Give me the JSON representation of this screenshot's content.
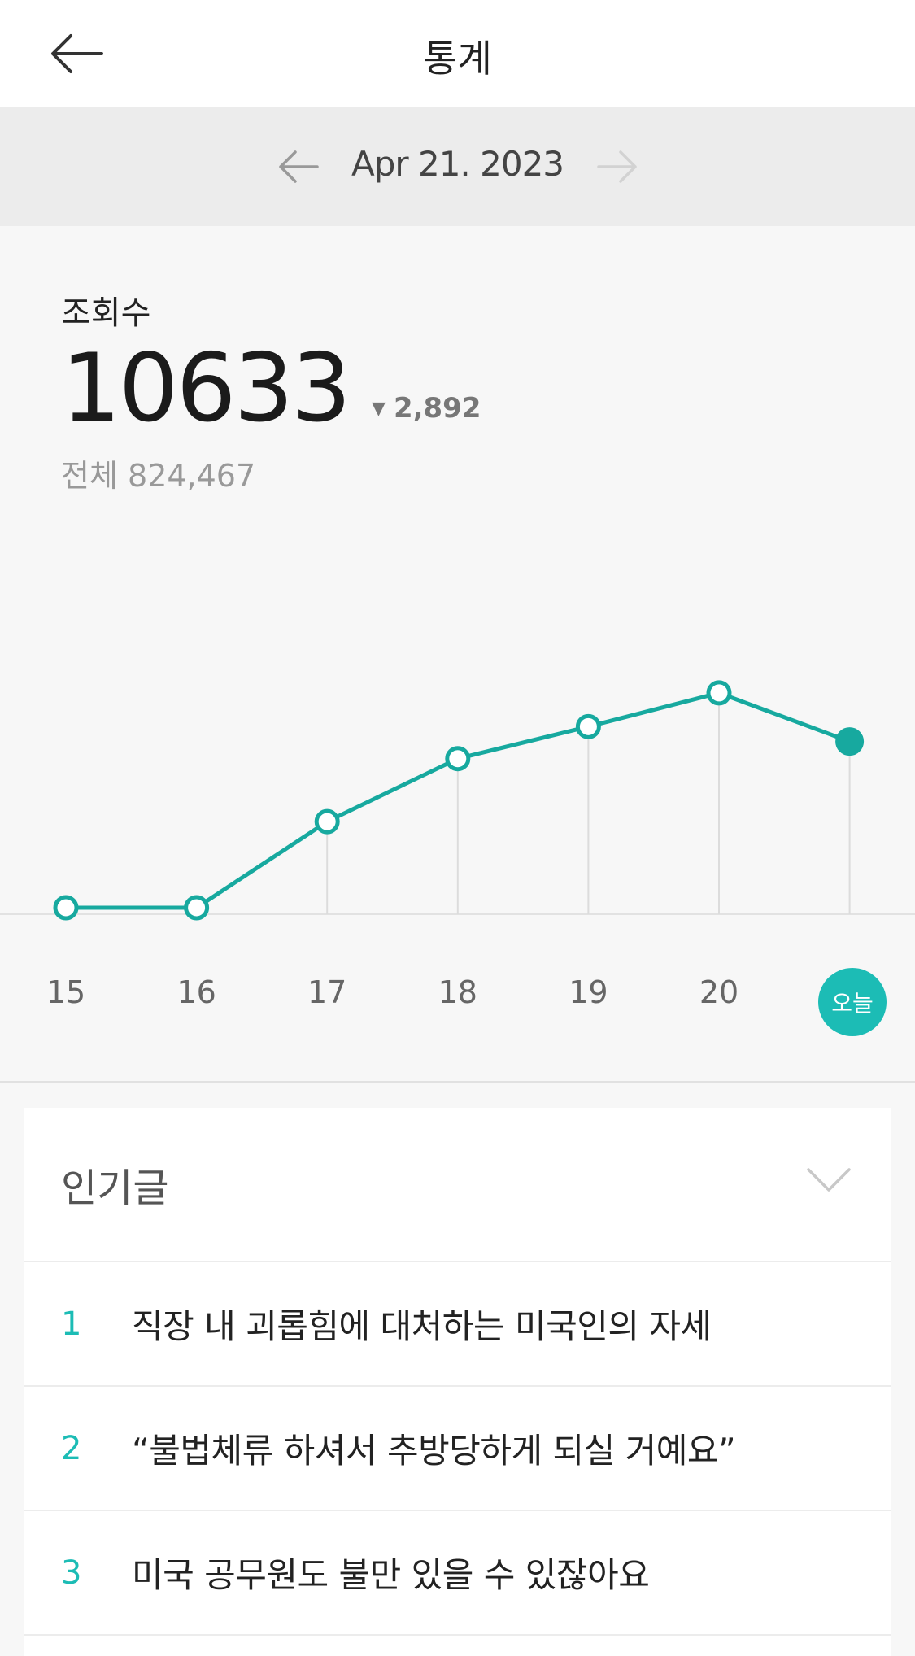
{
  "header": {
    "title": "통계",
    "back_icon": "arrow-left-icon"
  },
  "date_nav": {
    "date": "Apr 21. 2023",
    "prev_icon": "arrow-left-icon",
    "next_icon": "arrow-right-icon"
  },
  "stats": {
    "label": "조회수",
    "value": "10633",
    "delta": "2,892",
    "delta_direction": "down",
    "total_label": "전체",
    "total_value": "824,467"
  },
  "chart_data": {
    "type": "line",
    "categories": [
      "15",
      "16",
      "17",
      "18",
      "19",
      "20",
      "오늘"
    ],
    "values": [
      0,
      0,
      2890,
      5005,
      6080,
      7210,
      5580
    ],
    "today_index": 6,
    "accent": "#17a99f",
    "grid": false
  },
  "colors": {
    "accent": "#1cbcb5",
    "line": "#17a99f"
  },
  "popular": {
    "title": "인기글",
    "toggle_icon": "chevron-down-icon",
    "items": [
      {
        "rank": "1",
        "title": "직장 내 괴롭힘에 대처하는 미국인의 자세"
      },
      {
        "rank": "2",
        "title": "“불법체류 하셔서 추방당하게 되실 거예요”"
      },
      {
        "rank": "3",
        "title": "미국 공무원도 불만 있을 수 있잖아요"
      }
    ]
  }
}
